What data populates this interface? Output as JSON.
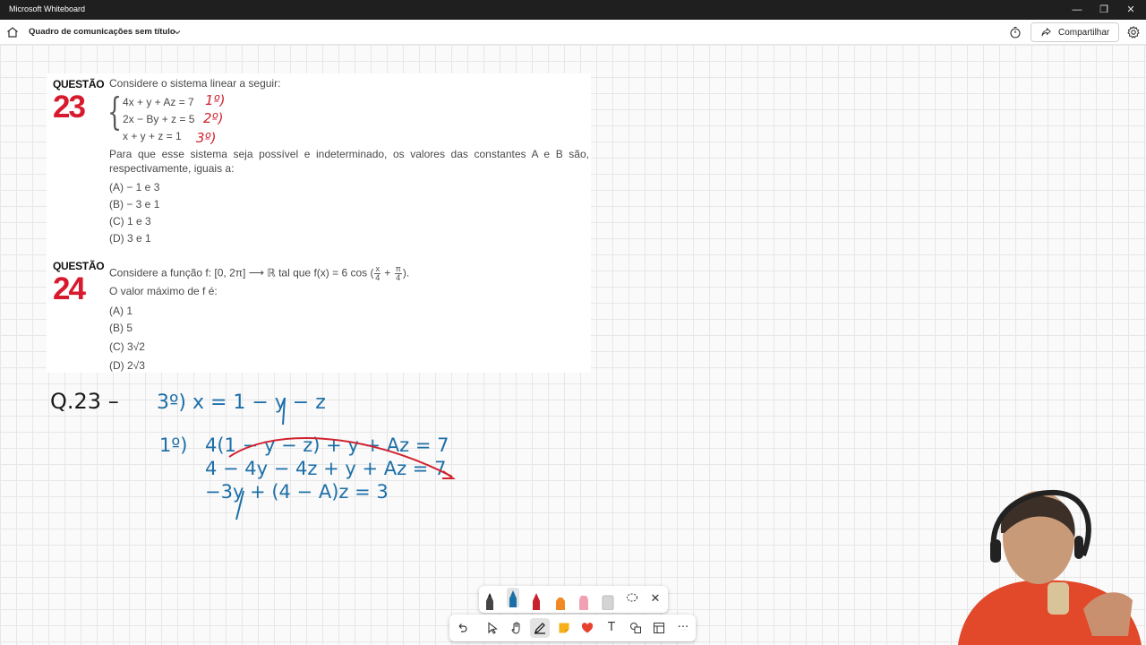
{
  "window": {
    "app_title": "Microsoft Whiteboard",
    "minimize_glyph": "—",
    "restore_glyph": "❐",
    "close_glyph": "✕"
  },
  "header": {
    "board_title": "Quadro de comunicações sem título",
    "share_label": "Compartilhar"
  },
  "questions": {
    "q23": {
      "label": "QUESTÃO",
      "number": "23",
      "intro": "Considere o sistema linear a seguir:",
      "equations": [
        "4x + y + Az = 7",
        "2x − By + z = 5",
        "x + y + z = 1"
      ],
      "prompt": "Para que esse sistema seja possível e indeterminado, os valores das constantes A e B são, respectivamente, iguais a:",
      "options": [
        "(A) − 1 e 3",
        "(B) − 3 e 1",
        "(C) 1 e 3",
        "(D) 3 e 1"
      ]
    },
    "q24": {
      "label": "QUESTÃO",
      "number": "24",
      "statement_pre": "Considere a função f: [0, 2π] ⟶ ℝ tal que f(x) = 6 cos (",
      "frac1_num": "x",
      "frac1_den": "4",
      "plus": " + ",
      "frac2_num": "π",
      "frac2_den": "4",
      "statement_post": ").",
      "question": "O valor máximo de f é:",
      "options": [
        "(A) 1",
        "(B) 5",
        "(C) 3√2",
        "(D) 2√3"
      ]
    }
  },
  "handwriting": {
    "eq_tags": [
      "1º)",
      "2º)",
      "3º)"
    ],
    "heading": "Q.23 –",
    "line1": "3º)  x = 1 − y − z",
    "line2_tag": "1º)",
    "line2": "4(1 − y − z) + y + Az = 7",
    "line3": "4 − 4y − 4z + y + Az = 7",
    "line4": "−3y + (4 − A)z = 3"
  },
  "colors": {
    "ink_blue": "#1d6fa8",
    "ink_red": "#d1232f",
    "ink_black": "#1a1a1a",
    "question_red": "#d71a2e"
  },
  "palette": {
    "pens": [
      "black-pen",
      "blue-pen",
      "red-pen",
      "orange-highlighter",
      "pink-highlighter",
      "eraser"
    ],
    "pen_colors": [
      "#222222",
      "#1d6fa8",
      "#c8202c",
      "#f08a24",
      "#f2a1b5",
      "#cfcfcf"
    ]
  },
  "toolbar": {
    "tools": [
      "undo-icon",
      "select-icon",
      "pan-hand-icon",
      "pen-icon",
      "sticky-note-icon",
      "reactions-icon",
      "text-icon",
      "shapes-icon",
      "templates-icon",
      "more-icon"
    ],
    "text_glyph": "T",
    "more_glyph": "···"
  }
}
